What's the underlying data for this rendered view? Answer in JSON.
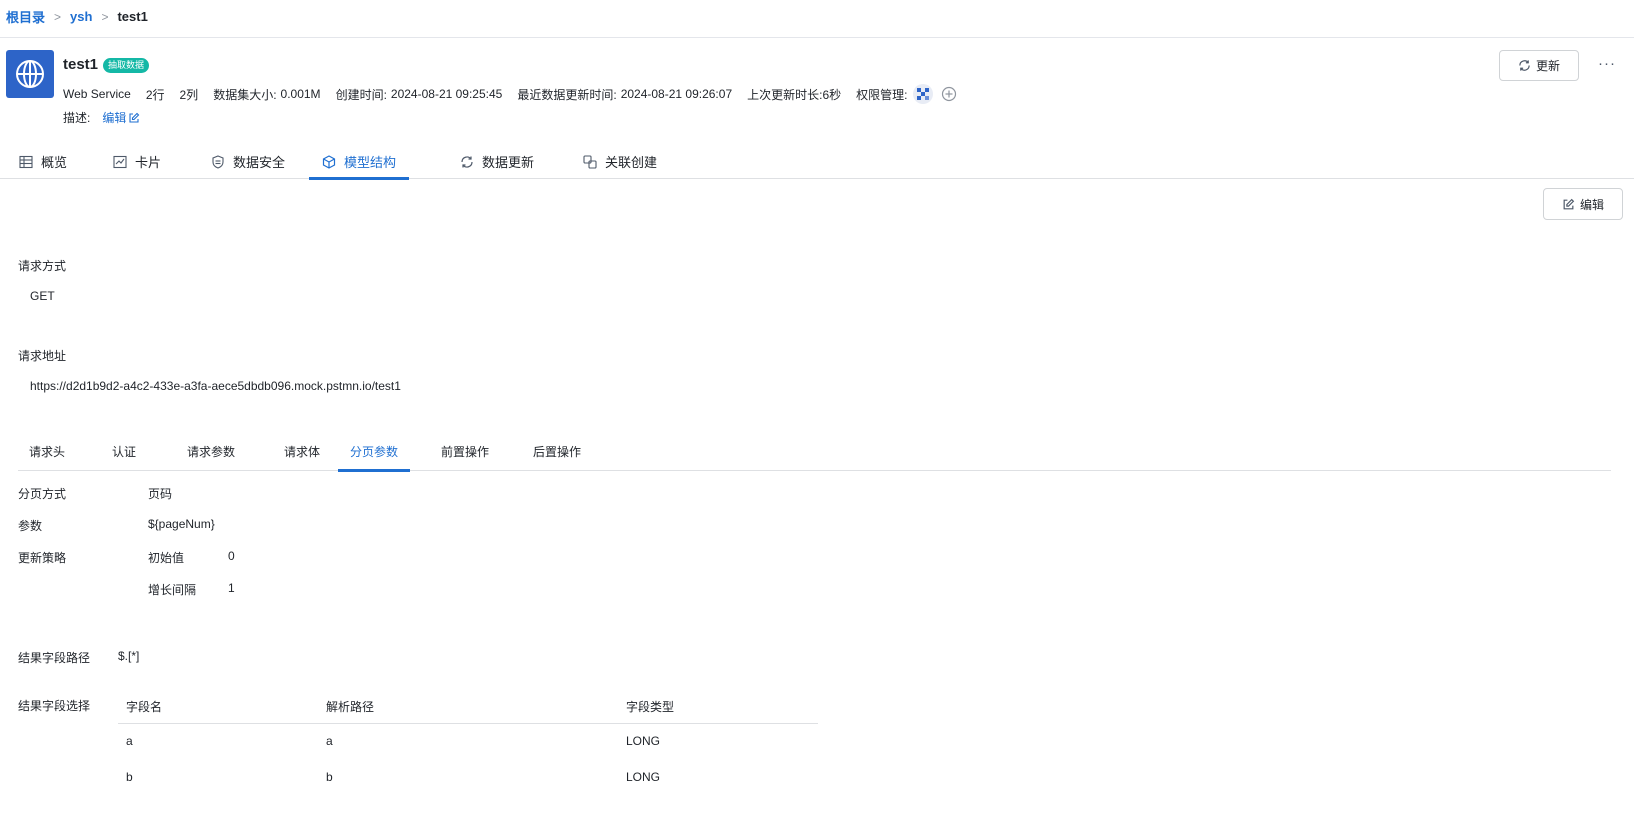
{
  "breadcrumb": {
    "root": "根目录",
    "folder": "ysh",
    "current": "test1",
    "separator": ">"
  },
  "dataset": {
    "title": "test1",
    "badge": "抽取数据",
    "type": "Web Service",
    "rows": "2行",
    "cols": "2列",
    "size_label": "数据集大小:",
    "size_value": "0.001M",
    "created_label": "创建时间:",
    "created_value": "2024-08-21 09:25:45",
    "updated_label": "最近数据更新时间:",
    "updated_value": "2024-08-21 09:26:07",
    "duration": "上次更新时长:6秒",
    "permission_label": "权限管理:",
    "desc_label": "描述:",
    "desc_edit": "编辑"
  },
  "header_actions": {
    "update": "更新",
    "more": "···"
  },
  "main_tabs": [
    {
      "label": "概览",
      "icon": "table-icon"
    },
    {
      "label": "卡片",
      "icon": "chart-icon"
    },
    {
      "label": "数据安全",
      "icon": "shield-icon"
    },
    {
      "label": "模型结构",
      "icon": "cube-icon",
      "active": true
    },
    {
      "label": "数据更新",
      "icon": "refresh-icon"
    },
    {
      "label": "关联创建",
      "icon": "link-icon"
    }
  ],
  "edit_button": "编辑",
  "request": {
    "method_label": "请求方式",
    "method_value": "GET",
    "url_label": "请求地址",
    "url_value": "https://d2d1b9d2-a4c2-433e-a3fa-aece5dbdb096.mock.pstmn.io/test1"
  },
  "sub_tabs": [
    {
      "label": "请求头"
    },
    {
      "label": "认证"
    },
    {
      "label": "请求参数"
    },
    {
      "label": "请求体"
    },
    {
      "label": "分页参数",
      "active": true
    },
    {
      "label": "前置操作"
    },
    {
      "label": "后置操作"
    }
  ],
  "pagination": {
    "mode_label": "分页方式",
    "mode_value": "页码",
    "param_label": "参数",
    "param_value": "${pageNum}",
    "strategy_label": "更新策略",
    "initial_label": "初始值",
    "initial_value": "0",
    "step_label": "增长间隔",
    "step_value": "1"
  },
  "result": {
    "path_label": "结果字段路径",
    "path_value": "$.[*]",
    "select_label": "结果字段选择",
    "columns": [
      "字段名",
      "解析路径",
      "字段类型"
    ],
    "rows": [
      [
        "a",
        "a",
        "LONG"
      ],
      [
        "b",
        "b",
        "LONG"
      ]
    ]
  },
  "colors": {
    "accent": "#1f6fd1",
    "badge": "#14b8a6",
    "icon_bg": "#2d64c8"
  }
}
